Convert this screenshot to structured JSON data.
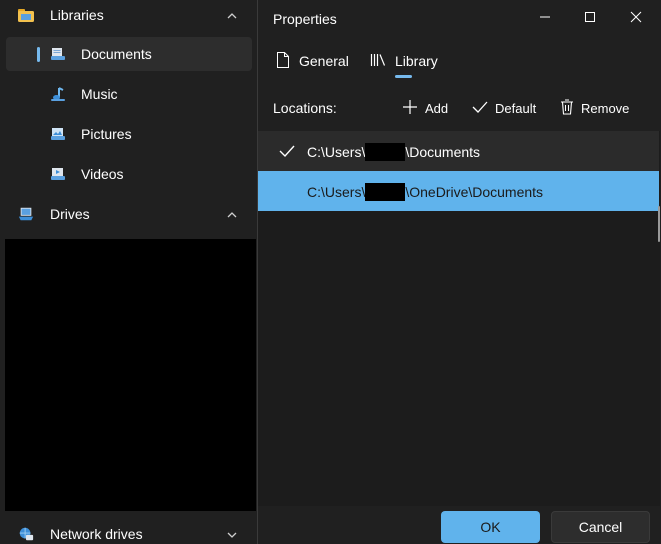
{
  "sidebar": {
    "libraries": {
      "label": "Libraries",
      "icon": "libraries-folder-icon",
      "color": "#f2c14e"
    },
    "items": [
      {
        "label": "Documents",
        "icon": "documents-icon",
        "selected": true
      },
      {
        "label": "Music",
        "icon": "music-icon",
        "selected": false
      },
      {
        "label": "Pictures",
        "icon": "pictures-icon",
        "selected": false
      },
      {
        "label": "Videos",
        "icon": "videos-icon",
        "selected": false
      }
    ],
    "drives": {
      "label": "Drives",
      "icon": "drives-icon"
    },
    "network_drives": {
      "label": "Network drives",
      "icon": "network-drives-icon"
    }
  },
  "dialog": {
    "title": "Properties",
    "tabs": [
      {
        "label": "General",
        "icon": "document-icon",
        "active": false
      },
      {
        "label": "Library",
        "icon": "library-icon",
        "active": true
      }
    ],
    "locations_label": "Locations:",
    "toolbar": {
      "add": "Add",
      "default": "Default",
      "remove": "Remove"
    },
    "locations": [
      {
        "prefix": "C:\\Users\\",
        "suffix": "\\Documents",
        "default": true,
        "selected": false
      },
      {
        "prefix": "C:\\Users\\",
        "suffix": "\\OneDrive\\Documents",
        "default": false,
        "selected": true
      }
    ],
    "ok": "OK",
    "cancel": "Cancel"
  },
  "colors": {
    "accent": "#60b3ec",
    "indicator": "#76b9ed",
    "background": "#202020"
  }
}
